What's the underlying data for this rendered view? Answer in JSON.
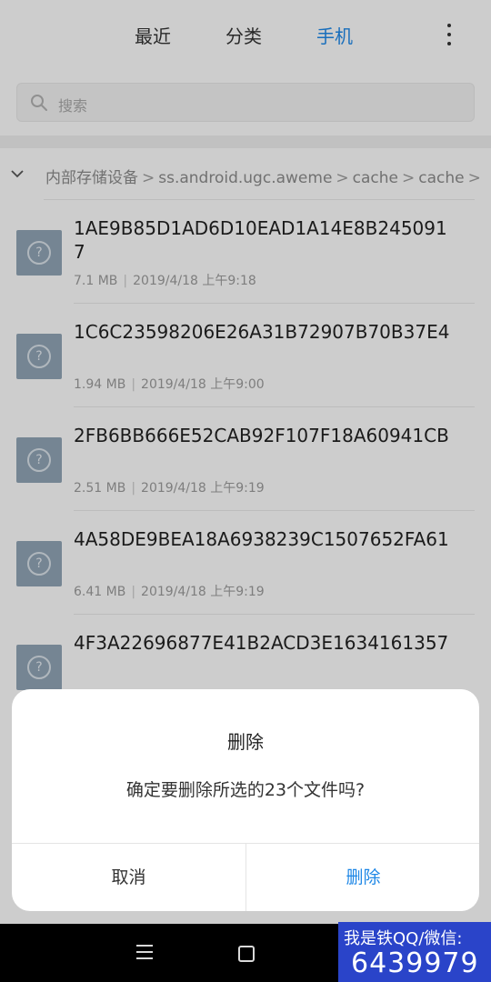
{
  "tabs": {
    "recent": "最近",
    "category": "分类",
    "phone": "手机"
  },
  "search": {
    "placeholder": "搜索"
  },
  "breadcrumb": [
    "内部存储设备",
    "ss.android.ugc.aweme",
    "cache",
    "cache"
  ],
  "files": [
    {
      "name": "1AE9B85D1AD6D10EAD1A14E8B2450917",
      "size": "7.1 MB",
      "date": "2019/4/18 上午9:18"
    },
    {
      "name": "1C6C23598206E26A31B72907B70B37E4",
      "size": "1.94 MB",
      "date": "2019/4/18 上午9:00"
    },
    {
      "name": "2FB6BB666E52CAB92F107F18A60941CB",
      "size": "2.51 MB",
      "date": "2019/4/18 上午9:19"
    },
    {
      "name": "4A58DE9BEA18A6938239C1507652FA61",
      "size": "6.41 MB",
      "date": "2019/4/18 上午9:19"
    },
    {
      "name": "4F3A22696877E41B2ACD3E1634161357",
      "size": "",
      "date": ""
    }
  ],
  "dialog": {
    "title": "删除",
    "message": "确定要删除所选的23个文件吗?",
    "cancel": "取消",
    "confirm": "删除"
  },
  "colors": {
    "accent": "#1e87e6"
  },
  "watermark": {
    "line1": "我是铁QQ/微信:",
    "line2": "6439979"
  }
}
